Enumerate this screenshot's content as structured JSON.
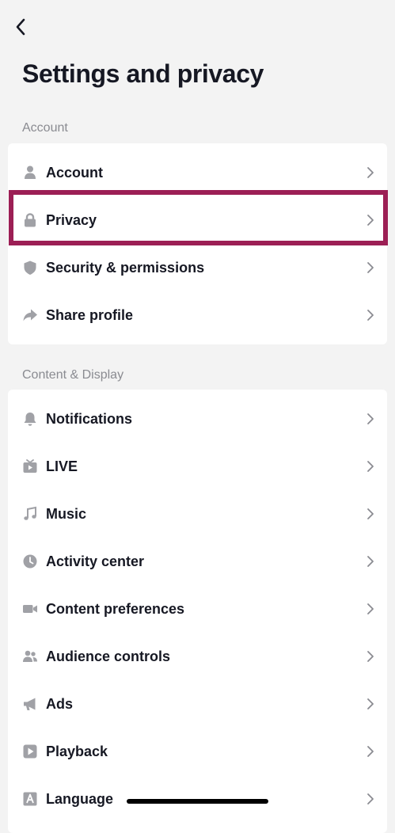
{
  "header": {
    "title": "Settings and privacy"
  },
  "sections": [
    {
      "title": "Account",
      "items": [
        {
          "label": "Account",
          "icon": "person-icon"
        },
        {
          "label": "Privacy",
          "icon": "lock-icon"
        },
        {
          "label": "Security & permissions",
          "icon": "shield-icon"
        },
        {
          "label": "Share profile",
          "icon": "share-arrow-icon"
        }
      ]
    },
    {
      "title": "Content & Display",
      "items": [
        {
          "label": "Notifications",
          "icon": "bell-icon"
        },
        {
          "label": "LIVE",
          "icon": "tv-icon"
        },
        {
          "label": "Music",
          "icon": "music-note-icon"
        },
        {
          "label": "Activity center",
          "icon": "clock-icon"
        },
        {
          "label": "Content preferences",
          "icon": "video-camera-icon"
        },
        {
          "label": "Audience controls",
          "icon": "people-icon"
        },
        {
          "label": "Ads",
          "icon": "megaphone-icon"
        },
        {
          "label": "Playback",
          "icon": "play-icon"
        },
        {
          "label": "Language",
          "icon": "letter-a-icon"
        }
      ]
    }
  ],
  "highlighted_item": "Privacy",
  "colors": {
    "background": "#f3f3f3",
    "card": "#ffffff",
    "text": "#161823",
    "secondary_text": "#8a8b91",
    "icon": "#a0a1a6",
    "highlight_border": "#9c1f55"
  }
}
